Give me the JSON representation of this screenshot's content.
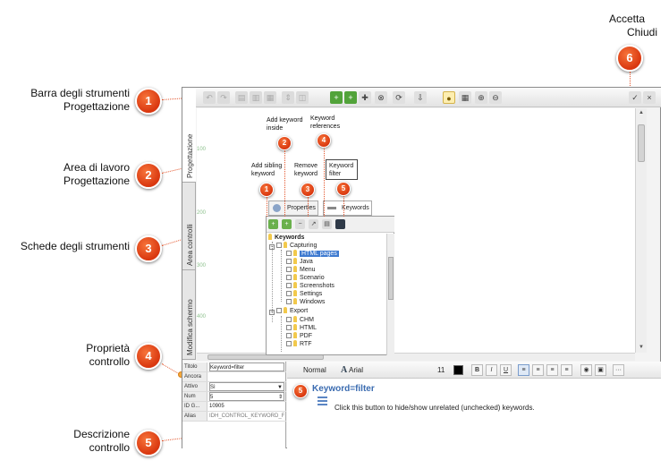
{
  "labels": {
    "toolbar": [
      "Barra degli strumenti",
      "Progettazione"
    ],
    "workarea": [
      "Area di lavoro",
      "Progettazione"
    ],
    "tooltabs": [
      "Schede degli strumenti"
    ],
    "props": [
      "Proprietà",
      "controllo"
    ],
    "desc": [
      "Descrizione",
      "controllo"
    ],
    "accept": "Accetta",
    "close": "Chiudi"
  },
  "badges": [
    "1",
    "2",
    "3",
    "4",
    "5",
    "6"
  ],
  "annotations": {
    "add_keyword": [
      "Add keyword",
      "inside"
    ],
    "keyword_refs": [
      "Keyword",
      "references"
    ],
    "add_sibling": [
      "Add sibling",
      "keyword"
    ],
    "remove_keyword": [
      "Remove",
      "keyword"
    ],
    "keyword_filter": [
      "Keyword",
      "filter"
    ]
  },
  "vertical_tabs": [
    "Progettazione",
    "Area controlli",
    "Modifica schermo"
  ],
  "ruler_ticks": [
    "100",
    "200",
    "300",
    "400"
  ],
  "panel": {
    "tab_properties": "Properties",
    "tab_keywords": "Keywords",
    "tree": [
      {
        "label": "Keywords",
        "level": 0,
        "bold": true
      },
      {
        "label": "Capturing",
        "level": 1,
        "expander": "−"
      },
      {
        "label": "HTML pages",
        "level": 2,
        "selected": true
      },
      {
        "label": "Java",
        "level": 2
      },
      {
        "label": "Menu",
        "level": 2
      },
      {
        "label": "Scenario",
        "level": 2
      },
      {
        "label": "Screenshots",
        "level": 2
      },
      {
        "label": "Settings",
        "level": 2
      },
      {
        "label": "Windows",
        "level": 2
      },
      {
        "label": "Export",
        "level": 1,
        "expander": "−"
      },
      {
        "label": "CHM",
        "level": 2
      },
      {
        "label": "HTML",
        "level": 2
      },
      {
        "label": "PDF",
        "level": 2
      },
      {
        "label": "RTF",
        "level": 2
      }
    ]
  },
  "properties": [
    {
      "key": "Titolo",
      "value": "Keyword=filter"
    },
    {
      "key": "Ancora",
      "value": ""
    },
    {
      "key": "Attivo",
      "value": "Sì"
    },
    {
      "key": "Num",
      "value": "5"
    },
    {
      "key": "ID G...",
      "value": "10905"
    },
    {
      "key": "Alias",
      "value": "IDH_CONTROL_KEYWORD_F..."
    }
  ],
  "editor": {
    "style": "Normal",
    "font": "Arial",
    "font_icon": "A",
    "size": "11",
    "bold": "B",
    "italic": "I",
    "underline": "U",
    "more": "···",
    "title": "Keyword=filter",
    "text": "Click this button to hide/show unrelated (unchecked) keywords."
  }
}
